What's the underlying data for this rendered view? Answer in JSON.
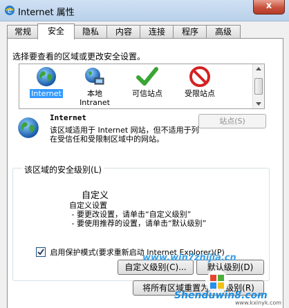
{
  "window": {
    "title": "Internet 属性",
    "close_label": "x"
  },
  "tabs": [
    {
      "label": "常规"
    },
    {
      "label": "安全"
    },
    {
      "label": "隐私"
    },
    {
      "label": "内容"
    },
    {
      "label": "连接"
    },
    {
      "label": "程序"
    },
    {
      "label": "高级"
    }
  ],
  "security": {
    "prompt": "选择要查看的区域或更改安全设置。",
    "zones": [
      {
        "label": "Internet",
        "icon": "globe-icon",
        "selected": true
      },
      {
        "label": "本地\nIntranet",
        "icon": "intranet-icon",
        "selected": false
      },
      {
        "label": "可信站点",
        "icon": "checkmark-icon",
        "selected": false
      },
      {
        "label": "受限站点",
        "icon": "restricted-icon",
        "selected": false
      }
    ],
    "selected_zone": {
      "name": "Internet",
      "description": "该区域适用于 Internet 网站，但不适用于列在受信任和受限制区域中的网站。"
    },
    "sites_button": "站点(S)",
    "group_title": "该区域的安全级别(L)",
    "level": {
      "title": "自定义",
      "text": "自定义设置\n - 要更改设置，请单击“自定义级别”\n - 要使用推荐的设置，请单击“默认级别”"
    },
    "protected_mode": {
      "label": "启用保护模式(要求重新启动 Internet Explorer)(P)",
      "checked": true
    },
    "custom_level_button": "自定义级别(C)...",
    "default_level_button": "默认级别(D)",
    "reset_all_button": "将所有区域重置为默认级别(R)"
  },
  "watermark": {
    "site_text": "www.win7zhijia.cn",
    "brand": "Shenduwin8.com",
    "brand_url": "www.kxinyk.com"
  },
  "colors": {
    "selection": "#3399ff",
    "panel": "#ffffff",
    "dialog": "#f0f0f0"
  }
}
